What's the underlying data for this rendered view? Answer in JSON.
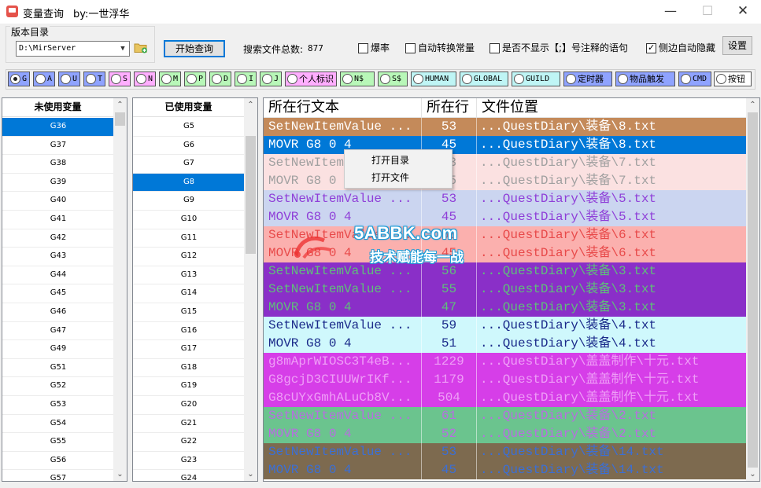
{
  "window": {
    "title": "变量查询",
    "author": "by:一世浮华",
    "min_glyph": "—",
    "max_glyph": "☐",
    "close_glyph": "✕"
  },
  "toolbar": {
    "dir_group_label": "版本目录",
    "dir_value": "D:\\MirServer",
    "query_button": "开始查询",
    "total_label": "搜索文件总数:",
    "total_value": "877",
    "checkboxes": [
      {
        "label": "爆率",
        "checked": false
      },
      {
        "label": "自动转换常量",
        "checked": false
      },
      {
        "label": "是否不显示【;】号注释的语句",
        "checked": false
      },
      {
        "label": "侧边自动隐藏",
        "checked": true
      }
    ],
    "settings_button": "设置"
  },
  "filters": [
    {
      "label": "G",
      "color": "#8fa3ff",
      "selected": true
    },
    {
      "label": "A",
      "color": "#8fa3ff",
      "selected": false
    },
    {
      "label": "U",
      "color": "#8fa3ff",
      "selected": false
    },
    {
      "label": "T",
      "color": "#8fa3ff",
      "selected": false
    },
    {
      "label": "S",
      "color": "#ffaeff",
      "selected": false
    },
    {
      "label": "N",
      "color": "#ffaeff",
      "selected": false
    },
    {
      "label": "M",
      "color": "#b8f7b8",
      "selected": false
    },
    {
      "label": "P",
      "color": "#b8f7b8",
      "selected": false
    },
    {
      "label": "D",
      "color": "#b8f7b8",
      "selected": false
    },
    {
      "label": "I",
      "color": "#b8f7b8",
      "selected": false
    },
    {
      "label": "J",
      "color": "#b8f7b8",
      "selected": false
    },
    {
      "label": "个人标识",
      "color": "#ffaeff",
      "selected": false
    },
    {
      "label": "N$",
      "color": "#b8f7b8",
      "selected": false
    },
    {
      "label": "S$",
      "color": "#b8f7b8",
      "selected": false
    },
    {
      "label": "HUMAN",
      "color": "#bff5f5",
      "selected": false
    },
    {
      "label": "GLOBAL",
      "color": "#bff5f5",
      "selected": false
    },
    {
      "label": "GUILD",
      "color": "#bff5f5",
      "selected": false
    },
    {
      "label": "定时器",
      "color": "#8fa3ff",
      "selected": false
    },
    {
      "label": "物品触发",
      "color": "#8fa3ff",
      "selected": false
    },
    {
      "label": "CMD",
      "color": "#8fa3ff",
      "selected": false
    },
    {
      "label": "按钮",
      "color": "#ffffff",
      "selected": false
    }
  ],
  "unused_list": {
    "header": "未使用变量",
    "items": [
      "G36",
      "G37",
      "G38",
      "G39",
      "G40",
      "G41",
      "G42",
      "G43",
      "G44",
      "G45",
      "G46",
      "G47",
      "G49",
      "G51",
      "G52",
      "G53",
      "G54",
      "G55",
      "G56",
      "G57"
    ],
    "selected_index": 0
  },
  "used_list": {
    "header": "已使用变量",
    "items": [
      "G5",
      "G6",
      "G7",
      "G8",
      "G9",
      "G10",
      "G11",
      "G12",
      "G13",
      "G14",
      "G15",
      "G16",
      "G17",
      "G18",
      "G19",
      "G20",
      "G21",
      "G22",
      "G23",
      "G24"
    ],
    "selected_index": 3
  },
  "results": {
    "columns": [
      "所在行文本",
      "所在行",
      "文件位置"
    ],
    "rows": [
      {
        "text": "SetNewItemValue ...",
        "line": "53",
        "file": "...QuestDiary\\装备\\8.txt",
        "bg": "#c48a5a",
        "fg": "#ffffff"
      },
      {
        "text": "MOVR G8 0 4",
        "line": "45",
        "file": "...QuestDiary\\装备\\8.txt",
        "bg": "#0078d7",
        "fg": "#ffffff"
      },
      {
        "text": "SetNewItemValue ...",
        "line": "53",
        "file": "...QuestDiary\\装备\\7.txt",
        "bg": "#fbe1e1",
        "fg": "#a0a0a0"
      },
      {
        "text": "MOVR G8 0 4",
        "line": "45",
        "file": "...QuestDiary\\装备\\7.txt",
        "bg": "#fbe1e1",
        "fg": "#a0a0a0"
      },
      {
        "text": "SetNewItemValue ...",
        "line": "53",
        "file": "...QuestDiary\\装备\\5.txt",
        "bg": "#cbd5f0",
        "fg": "#8f3fd8"
      },
      {
        "text": "MOVR G8 0 4",
        "line": "45",
        "file": "...QuestDiary\\装备\\5.txt",
        "bg": "#cbd5f0",
        "fg": "#8f3fd8"
      },
      {
        "text": "SetNewItemValue ...",
        "line": "53",
        "file": "...QuestDiary\\装备\\6.txt",
        "bg": "#fbb0ae",
        "fg": "#e84a4a"
      },
      {
        "text": "MOVR G8 0 4",
        "line": "45",
        "file": "...QuestDiary\\装备\\6.txt",
        "bg": "#fbb0ae",
        "fg": "#e84a4a"
      },
      {
        "text": "SetNewItemValue ...",
        "line": "56",
        "file": "...QuestDiary\\装备\\3.txt",
        "bg": "#8a2fc8",
        "fg": "#5fbf7a"
      },
      {
        "text": "SetNewItemValue ...",
        "line": "55",
        "file": "...QuestDiary\\装备\\3.txt",
        "bg": "#8a2fc8",
        "fg": "#5fbf7a"
      },
      {
        "text": "MOVR G8 0 4",
        "line": "47",
        "file": "...QuestDiary\\装备\\3.txt",
        "bg": "#8a2fc8",
        "fg": "#5fbf7a"
      },
      {
        "text": "SetNewItemValue ...",
        "line": "59",
        "file": "...QuestDiary\\装备\\4.txt",
        "bg": "#cff8fc",
        "fg": "#1a2a8a"
      },
      {
        "text": "MOVR G8 0 4",
        "line": "51",
        "file": "...QuestDiary\\装备\\4.txt",
        "bg": "#cff8fc",
        "fg": "#1a2a8a"
      },
      {
        "text": "g8mAprWIOSC3T4eB...",
        "line": "1229",
        "file": "...QuestDiary\\盖盖制作\\十元.txt",
        "bg": "#d63ee8",
        "fg": "#ef9ef7"
      },
      {
        "text": "G8gcjD3CIUUWrIKf...",
        "line": "1179",
        "file": "...QuestDiary\\盖盖制作\\十元.txt",
        "bg": "#d63ee8",
        "fg": "#ef9ef7"
      },
      {
        "text": "G8cUYxGmhALuCb8V...",
        "line": "504",
        "file": "...QuestDiary\\盖盖制作\\十元.txt",
        "bg": "#d63ee8",
        "fg": "#ef9ef7"
      },
      {
        "text": "SetNewItemValue ...",
        "line": "61",
        "file": "...QuestDiary\\装备\\2.txt",
        "bg": "#6bc48e",
        "fg": "#b76ee0"
      },
      {
        "text": "MOVR G8 0 4",
        "line": "52",
        "file": "...QuestDiary\\装备\\2.txt",
        "bg": "#6bc48e",
        "fg": "#b76ee0"
      },
      {
        "text": "SetNewItemValue ...",
        "line": "53",
        "file": "...QuestDiary\\装备\\14.txt",
        "bg": "#7d6a4f",
        "fg": "#3b6fd6"
      },
      {
        "text": "MOVR G8 0 4",
        "line": "45",
        "file": "...QuestDiary\\装备\\14.txt",
        "bg": "#7d6a4f",
        "fg": "#3b6fd6"
      }
    ]
  },
  "context_menu": {
    "items": [
      "打开目录",
      "打开文件"
    ]
  },
  "watermark": {
    "site": "5ABBK.com",
    "slogan": "技术赋能每一战"
  }
}
